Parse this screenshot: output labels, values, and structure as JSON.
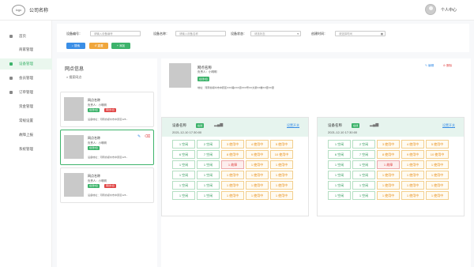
{
  "header": {
    "logo": "logo",
    "company": "公司名称",
    "user_center": "个人中心"
  },
  "sidebar": {
    "items": [
      {
        "label": "首页",
        "icon": "home-icon"
      },
      {
        "label": "商家管理",
        "icon": ""
      },
      {
        "label": "设备管理",
        "icon": "device-icon",
        "active": true
      },
      {
        "label": "会员管理",
        "icon": "member-icon"
      },
      {
        "label": "订单管理",
        "icon": "order-icon"
      },
      {
        "label": "资金管理",
        "icon": ""
      },
      {
        "label": "常规设置",
        "icon": ""
      },
      {
        "label": "故障上报",
        "icon": ""
      },
      {
        "label": "系统管理",
        "icon": ""
      }
    ]
  },
  "filter": {
    "device_no_label": "设备编号：",
    "device_no_placeholder": "请输入设备编号",
    "device_name_label": "设备名称：",
    "device_name_placeholder": "请输入设备名称",
    "status_label": "设备状态：",
    "status_value": "请选状态",
    "created_label": "创建时间：",
    "created_placeholder": "请选择时间",
    "search_btn": "搜索",
    "reset_btn": "重置",
    "add_btn": "添加"
  },
  "outlets": {
    "title": "网点信息",
    "search_placeholder": "搜索网点",
    "cards": [
      {
        "name": "网点名称",
        "person": "负责人：小明明",
        "tags": [
          "在线3台",
          "离线1台"
        ],
        "address": "设备地址：河南省郑州市中原区125..."
      },
      {
        "name": "网点名称",
        "person": "负责人：小明明",
        "tags": [
          "在线3台"
        ],
        "address": "设备地址：河南省郑州市中原区125..."
      },
      {
        "name": "网点名称",
        "person": "负责人：小明明",
        "tags": [
          "在线3台",
          "离线1台"
        ],
        "address": "设备地址：河南省郑州市中原区125..."
      }
    ]
  },
  "detail": {
    "name": "网点名称",
    "person": "负责人：小明明",
    "tag": "在线3台",
    "address": "地址：河南省郑州市中原区XXX路XXX街XXX号XX大厦XX楼XX室XX室",
    "edit": "编辑",
    "delete": "删除"
  },
  "devices": [
    {
      "name": "设备名称",
      "status": "在线",
      "time": "2021-12-10  17:30:00",
      "link": "设置开关",
      "cells": [
        "1 空闲",
        "2 空闲",
        "3 使用中",
        "4 使用中",
        "5 使用中",
        "6 空闲",
        "7 空闲",
        "8 使用中",
        "9 使用中",
        "10 使用中",
        "1 空闲",
        "1 空闲",
        "1 故障",
        "1 使用中",
        "1 使用中",
        "1 空闲",
        "1 空闲",
        "1 使用中",
        "1 使用中",
        "1 使用中",
        "1 空闲",
        "1 空闲",
        "1 使用中",
        "1 使用中",
        "1 使用中",
        "1 空闲",
        "1 空闲",
        "1 使用中",
        "1 使用中",
        "1 使用中"
      ],
      "states": [
        "idle",
        "idle",
        "busy",
        "busy",
        "busy",
        "idle",
        "idle",
        "busy",
        "busy",
        "busy",
        "idle",
        "idle",
        "fault",
        "busy",
        "busy",
        "idle",
        "idle",
        "busy",
        "busy",
        "busy",
        "idle",
        "idle",
        "busy",
        "busy",
        "busy",
        "idle",
        "idle",
        "busy",
        "busy",
        "busy"
      ]
    },
    {
      "name": "设备名称",
      "status": "在线",
      "time": "2021-12-10  17:30:00",
      "link": "设置开关",
      "cells": [
        "1 空闲",
        "2 空闲",
        "3 使用中",
        "4 使用中",
        "5 使用中",
        "6 空闲",
        "7 空闲",
        "8 使用中",
        "9 使用中",
        "10 使用中",
        "1 空闲",
        "1 空闲",
        "1 故障",
        "1 使用中",
        "1 使用中",
        "1 空闲",
        "1 空闲",
        "1 使用中",
        "1 使用中",
        "1 使用中",
        "1 空闲",
        "1 空闲",
        "1 使用中",
        "1 使用中",
        "1 使用中",
        "1 空闲",
        "1 空闲",
        "1 使用中",
        "1 使用中",
        "1 使用中"
      ],
      "states": [
        "idle",
        "idle",
        "busy",
        "busy",
        "busy",
        "idle",
        "idle",
        "busy",
        "busy",
        "busy",
        "idle",
        "idle",
        "fault",
        "busy",
        "busy",
        "idle",
        "idle",
        "busy",
        "busy",
        "busy",
        "idle",
        "idle",
        "busy",
        "busy",
        "busy",
        "idle",
        "idle",
        "busy",
        "busy",
        "busy"
      ]
    }
  ],
  "colors": {
    "accent": "#3db36b",
    "online": "#3db36b",
    "offline": "#e04545",
    "link": "#3a8ee6",
    "search": "#3a8ee6",
    "reset": "#f0a63b"
  }
}
